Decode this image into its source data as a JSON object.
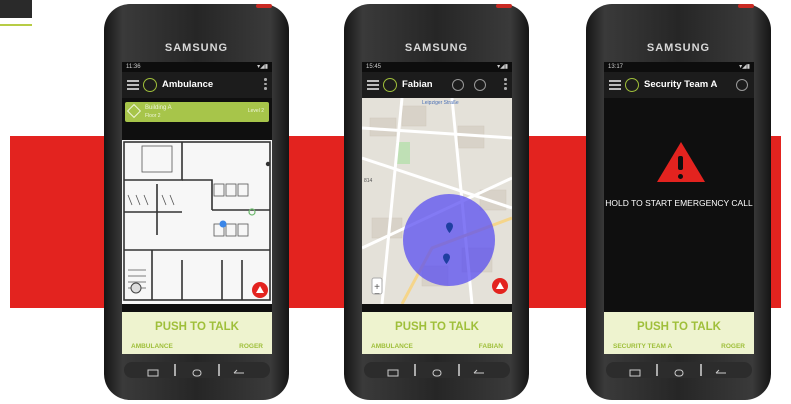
{
  "phones": [
    {
      "brand": "SAMSUNG",
      "status_time": "11:36",
      "title": "Ambulance",
      "location": {
        "building": "Building A",
        "floor": "Floor 2",
        "extra": "Level 2"
      },
      "ptt": {
        "label": "PUSH TO TALK",
        "left": "AMBULANCE",
        "right": "ROGER"
      }
    },
    {
      "brand": "SAMSUNG",
      "status_time": "15:45",
      "title": "Fabian",
      "map": {
        "street_label": "Leipziger Straße",
        "number_label": "814"
      },
      "ptt": {
        "label": "PUSH TO TALK",
        "left": "AMBULANCE",
        "right": "FABIAN"
      }
    },
    {
      "brand": "SAMSUNG",
      "status_time": "13:17",
      "title": "Security Team A",
      "emergency": {
        "text": "HOLD TO START EMERGENCY CALL"
      },
      "ptt": {
        "label": "PUSH TO TALK",
        "left": "SECURITY TEAM A",
        "right": "ROGER"
      }
    }
  ],
  "colors": {
    "accent_green": "#9fbf3a",
    "alert_red": "#e3231f",
    "map_blue": "#5a4df0"
  }
}
